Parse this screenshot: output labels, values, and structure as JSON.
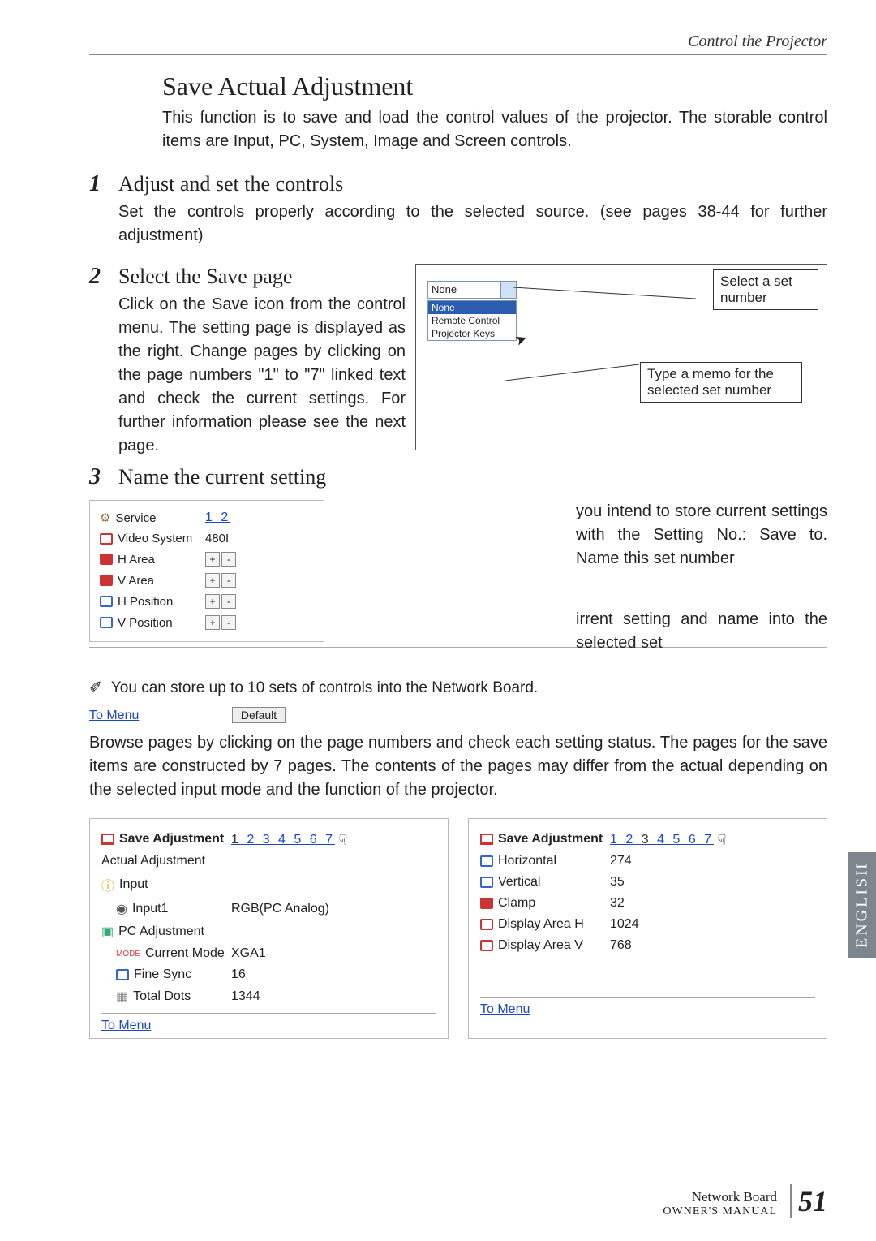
{
  "header": {
    "breadcrumb": "Control the Projector"
  },
  "main": {
    "title": "Save Actual Adjustment",
    "intro": "This function is to save and load the control values of the projector. The storable control items are Input, PC, System, Image and Screen controls."
  },
  "steps": {
    "s1": {
      "num": "1",
      "title": "Adjust and set the controls",
      "body": "Set the controls properly according to the selected source. (see pages 38-44 for further adjustment)"
    },
    "s2": {
      "num": "2",
      "title": "Select the Save page",
      "body": "Click on the Save icon from the control menu. The setting page is displayed as the right. Change pages by clicking on the page numbers \"1\" to \"7\" linked text and check the current settings. For further information please see the next page."
    },
    "s3": {
      "num": "3",
      "title": "Name the current setting",
      "body_a": "you intend to store current settings with the Setting No.: Save to. Name this set number",
      "body_b": "irrent setting and name into the selected set"
    }
  },
  "dropdown": {
    "selected": "None",
    "opt_sel": "None",
    "opt2": "Remote Control",
    "opt3": "Projector Keys"
  },
  "callouts": {
    "c1": "Select a set number",
    "c2": "Type a memo for the selected set number"
  },
  "mini": {
    "service": {
      "label": "Service",
      "pages": "1 2"
    },
    "videosys": {
      "label": "Video System",
      "value": "480I"
    },
    "harea": {
      "label": "H Area"
    },
    "varea": {
      "label": "V Area"
    },
    "hpos": {
      "label": "H Position"
    },
    "vpos": {
      "label": "V Position"
    }
  },
  "note": "You can store up to 10 sets of controls into the Network Board.",
  "toolbar": {
    "to_menu": "To Menu",
    "default": "Default"
  },
  "browse": "Browse pages by clicking on the page numbers and check each setting status. The pages for the save items are constructed by 7 pages. The contents of the pages may differ from the actual depending on the selected input mode and the function of the projector.",
  "cardA": {
    "title": "Save Adjustment",
    "pages_pre": "1",
    "pages_post": "2 3 4 5 6 7",
    "row1": "Actual Adjustment",
    "row2": "Input",
    "row3": {
      "label": "Input1",
      "value": "RGB(PC Analog)"
    },
    "row4": "PC Adjustment",
    "row5": {
      "label": "Current Mode",
      "value": "XGA1"
    },
    "row6": {
      "label": "Fine Sync",
      "value": "16"
    },
    "row7": {
      "label": "Total Dots",
      "value": "1344"
    }
  },
  "cardB": {
    "title": "Save Adjustment",
    "pages_pre": "1 2",
    "pages_mid": "3",
    "pages_post": "4 5 6 7",
    "row1": {
      "label": "Horizontal",
      "value": "274"
    },
    "row2": {
      "label": "Vertical",
      "value": "35"
    },
    "row3": {
      "label": "Clamp",
      "value": "32"
    },
    "row4": {
      "label": "Display Area H",
      "value": "1024"
    },
    "row5": {
      "label": "Display Area V",
      "value": "768"
    }
  },
  "sidebar": {
    "english": "ENGLISH"
  },
  "footer": {
    "line1": "Network Board",
    "line2": "OWNER'S MANUAL",
    "page": "51"
  }
}
